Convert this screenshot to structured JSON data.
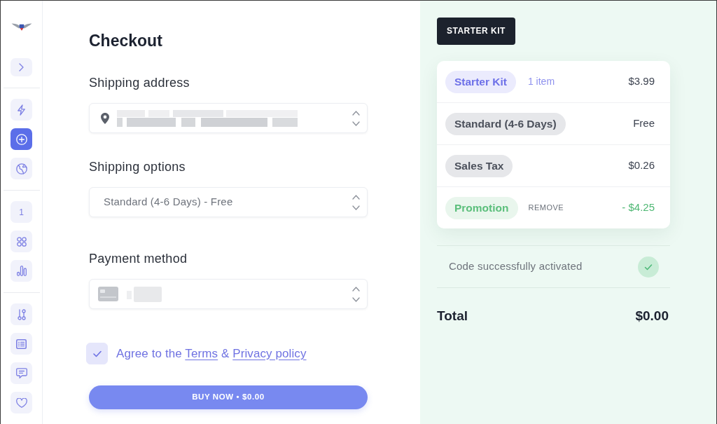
{
  "sidebar": {
    "toggle": {
      "expanded": false
    },
    "groups": [
      [
        {
          "kind": "icon",
          "selected": false
        },
        {
          "kind": "icon",
          "selected": true
        },
        {
          "kind": "icon",
          "selected": false
        }
      ],
      [
        {
          "kind": "label",
          "label": "1",
          "selected": false
        },
        {
          "kind": "icon",
          "selected": false
        },
        {
          "kind": "icon",
          "selected": false
        }
      ],
      [
        {
          "kind": "icon",
          "selected": false
        },
        {
          "kind": "icon",
          "selected": false
        },
        {
          "kind": "icon",
          "selected": false
        },
        {
          "kind": "icon",
          "selected": false
        }
      ]
    ]
  },
  "checkout": {
    "title": "Checkout",
    "fields": [
      {
        "kind": "address",
        "label": "Shipping address"
      },
      {
        "kind": "select",
        "label": "Shipping options",
        "value": "Standard (4-6 Days) - Free"
      },
      {
        "kind": "card",
        "label": "Payment method"
      }
    ],
    "agreement": {
      "checked": true,
      "text": "Agree to the",
      "terms_link": "Terms",
      "joiner": "&",
      "privacy_link": "Privacy policy"
    },
    "buy_button": "BUY NOW • $0.00"
  },
  "order_summary": {
    "product_tag": "STARTER KIT",
    "lines": [
      {
        "kind": "product",
        "label": "Starter Kit",
        "note": "1 item",
        "amount": "$3.99"
      },
      {
        "kind": "shipping",
        "label": "Standard (4-6 Days)",
        "amount": "Free"
      },
      {
        "kind": "tax",
        "label": "Sales Tax",
        "amount": "$0.26"
      },
      {
        "kind": "promotion",
        "label": "Promotion",
        "action": "REMOVE",
        "amount": "- $4.25"
      }
    ],
    "promo_status": {
      "text": "Code successfully activated",
      "activated": true
    },
    "total": {
      "label": "Total",
      "amount": "$0.00"
    }
  }
}
